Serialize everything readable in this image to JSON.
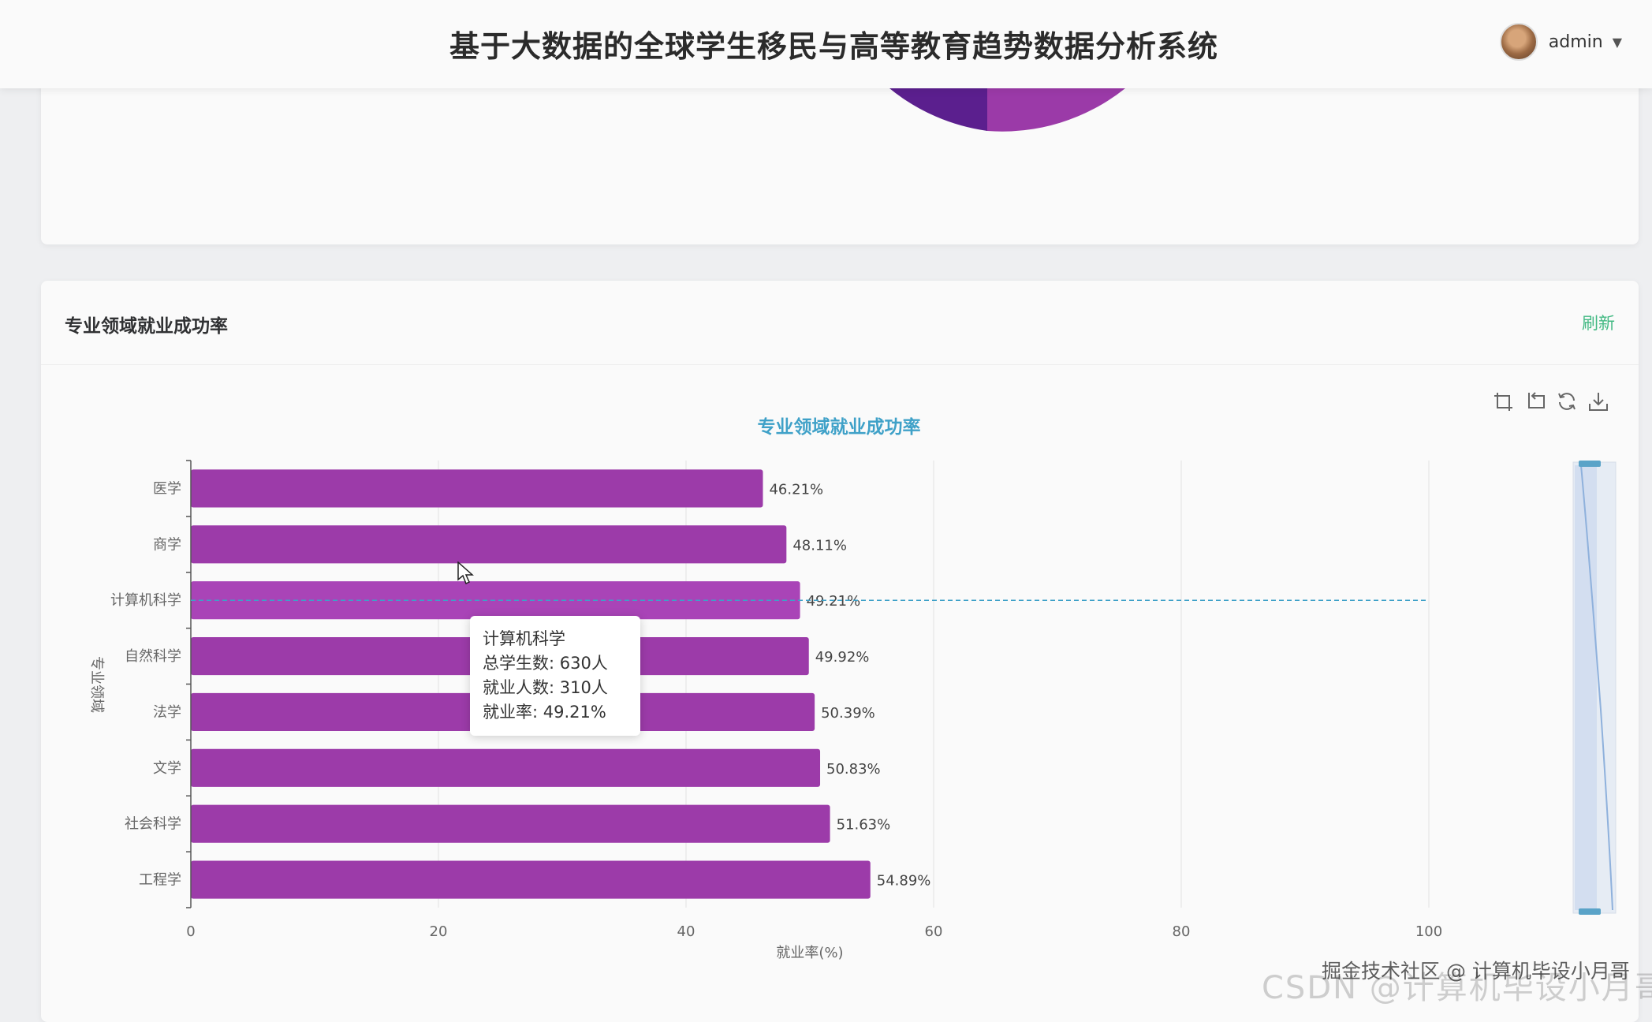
{
  "header": {
    "title": "基于大数据的全球学生移民与高等教育趋势数据分析系统",
    "user_name": "admin",
    "caret": "▼"
  },
  "top_card": {
    "pie_colors": [
      "#5b1f8e",
      "#9b3aa8"
    ]
  },
  "card": {
    "title": "专业领域就业成功率",
    "refresh_label": "刷新",
    "toolbox": [
      "zoom-icon",
      "zoom-reset-icon",
      "restore-icon",
      "save-image-icon"
    ]
  },
  "chart_data": {
    "type": "bar",
    "orientation": "horizontal",
    "title": "专业领域就业成功率",
    "xlabel": "就业率(%)",
    "ylabel": "专业领域",
    "xlim": [
      0,
      100
    ],
    "xticks": [
      0,
      20,
      40,
      60,
      80,
      100
    ],
    "categories": [
      "医学",
      "商学",
      "计算机科学",
      "自然科学",
      "法学",
      "文学",
      "社会科学",
      "工程学"
    ],
    "values": [
      46.21,
      48.11,
      49.21,
      49.92,
      50.39,
      50.83,
      51.63,
      54.89
    ],
    "value_labels": [
      "46.21%",
      "48.11%",
      "49.21%",
      "49.92%",
      "50.39%",
      "50.83%",
      "51.63%",
      "54.89%"
    ],
    "grid": true,
    "bar_color": "#9c3ba9",
    "highlight_color": "#a944b7",
    "title_color": "#3fa1c8",
    "highlighted_category": "计算机科学",
    "datazoom": "right-vertical-slider"
  },
  "tooltip": {
    "category": "计算机科学",
    "total_students": "总学生数: 630人",
    "employed": "就业人数: 310人",
    "rate": "就业率: 49.21%"
  },
  "watermark": {
    "line1": "掘金技术社区 @ 计算机毕设小月哥",
    "line2": "CSDN @计算机毕设小月哥"
  }
}
